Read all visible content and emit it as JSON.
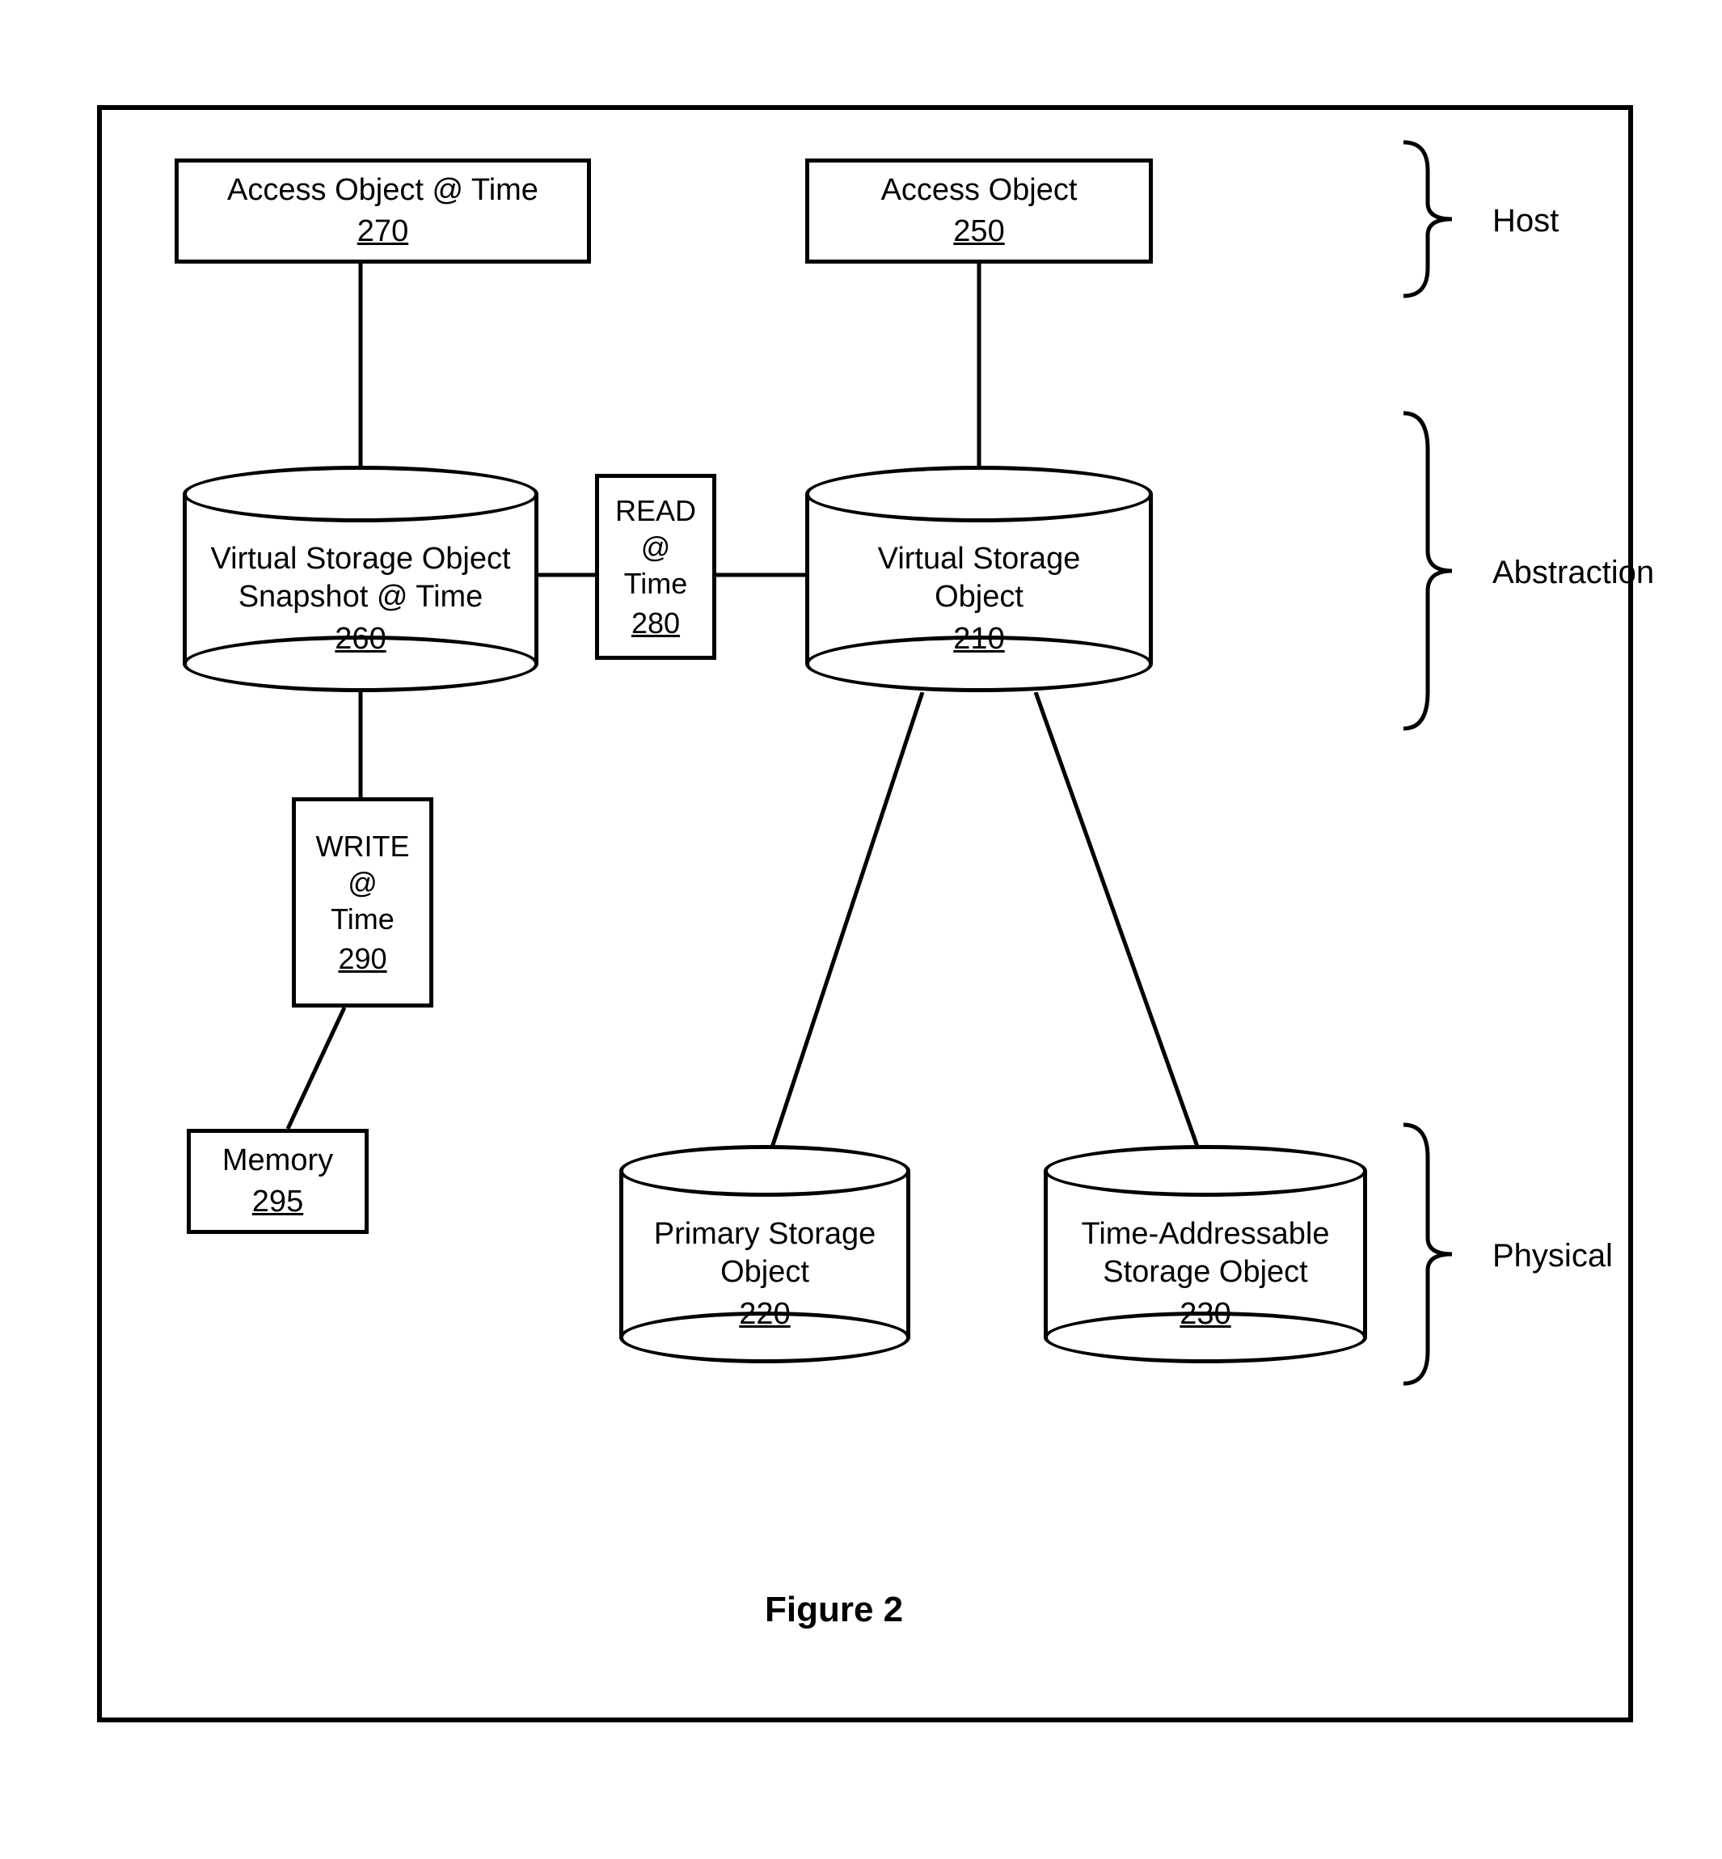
{
  "boxes": {
    "access_time": {
      "title": "Access Object @ Time",
      "ref": "270"
    },
    "access_obj": {
      "title": "Access Object",
      "ref": "250"
    },
    "read": {
      "l1": "READ",
      "l2": "@",
      "l3": "Time",
      "ref": "280"
    },
    "write": {
      "l1": "WRITE",
      "l2": "@",
      "l3": "Time",
      "ref": "290"
    },
    "memory": {
      "title": "Memory",
      "ref": "295"
    }
  },
  "cylinders": {
    "vso_snapshot": {
      "l1": "Virtual Storage Object",
      "l2": "Snapshot @ Time",
      "ref": "260"
    },
    "vso": {
      "l1": "Virtual Storage",
      "l2": "Object",
      "ref": "210"
    },
    "primary": {
      "l1": "Primary Storage",
      "l2": "Object",
      "ref": "220"
    },
    "timeaddr": {
      "l1": "Time-Addressable",
      "l2": "Storage Object",
      "ref": "230"
    }
  },
  "layers": {
    "host": "Host",
    "abstraction": "Abstraction",
    "physical": "Physical"
  },
  "caption": "Figure 2"
}
